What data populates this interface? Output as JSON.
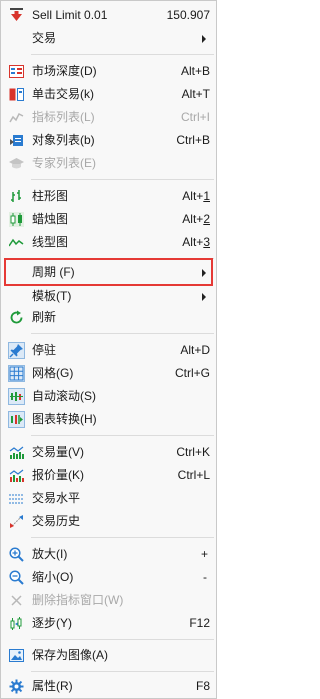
{
  "menu": {
    "sell_limit": {
      "label": "Sell Limit 0.01",
      "value": "150.907"
    },
    "trade": {
      "label": "交易"
    },
    "market_depth": {
      "label": "市场深度(D)",
      "shortcut": "Alt+B"
    },
    "one_click": {
      "label": "单击交易(k)",
      "shortcut": "Alt+T"
    },
    "indicator_list": {
      "label": "指标列表(L)",
      "shortcut": "Ctrl+I"
    },
    "object_list": {
      "label": "对象列表(b)",
      "shortcut": "Ctrl+B"
    },
    "expert_list": {
      "label": "专家列表(E)"
    },
    "bar_chart": {
      "label": "柱形图",
      "shortcut_prefix": "Alt+",
      "shortcut_key": "1"
    },
    "candle_chart": {
      "label": "蜡烛图",
      "shortcut_prefix": "Alt+",
      "shortcut_key": "2"
    },
    "line_chart": {
      "label": "线型图",
      "shortcut_prefix": "Alt+",
      "shortcut_key": "3"
    },
    "period": {
      "label": "周期 (F)"
    },
    "template": {
      "label": "模板(T)"
    },
    "refresh": {
      "label": "刷新"
    },
    "dock": {
      "label": "停驻",
      "shortcut": "Alt+D"
    },
    "grid": {
      "label": "网格(G)",
      "shortcut": "Ctrl+G"
    },
    "autoscroll": {
      "label": "自动滚动(S)"
    },
    "chart_shift": {
      "label": "图表转换(H)"
    },
    "volume": {
      "label": "交易量(V)",
      "shortcut": "Ctrl+K"
    },
    "tick_volume": {
      "label": "报价量(K)",
      "shortcut": "Ctrl+L"
    },
    "trade_level": {
      "label": "交易水平"
    },
    "trade_history": {
      "label": "交易历史"
    },
    "zoom_in": {
      "label": "放大(I)",
      "shortcut": "+"
    },
    "zoom_out": {
      "label": "缩小(O)",
      "shortcut": "-"
    },
    "delete_indicator_window": {
      "label": "删除指标窗口(W)"
    },
    "step": {
      "label": "逐步(Y)",
      "shortcut": "F12"
    },
    "save_image": {
      "label": "保存为图像(A)"
    },
    "properties": {
      "label": "属性(R)",
      "shortcut": "F8"
    }
  },
  "colors": {
    "highlight_border": "#e53935",
    "icon_blue": "#2a7bd0",
    "icon_green": "#1f9a3a",
    "icon_red": "#d8342c"
  }
}
